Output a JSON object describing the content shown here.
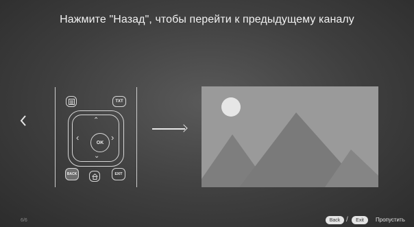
{
  "instruction": "Нажмите \"Назад\", чтобы перейти к предыдущему каналу",
  "nav": {
    "prev_icon": "chevron-left-icon",
    "prev_glyph": "‹"
  },
  "remote": {
    "menu_icon": "menu-icon",
    "txt_label": "TXT",
    "ok_label": "OK",
    "back_label": "BACK",
    "home_icon": "home-icon",
    "exit_label": "EXIT",
    "up_glyph": "⌃",
    "down_glyph": "⌄",
    "left_glyph": "‹",
    "right_glyph": "›"
  },
  "preview": {
    "icon": "image-placeholder-icon"
  },
  "footer": {
    "page": "6/6",
    "back_label": "Back",
    "slash": "/",
    "exit_label": "Exit",
    "skip_label": "Пропустить"
  },
  "colors": {
    "background": "#3e3e3e",
    "preview_bg": "#9a9a9a",
    "highlight": "#6e6e6e"
  }
}
